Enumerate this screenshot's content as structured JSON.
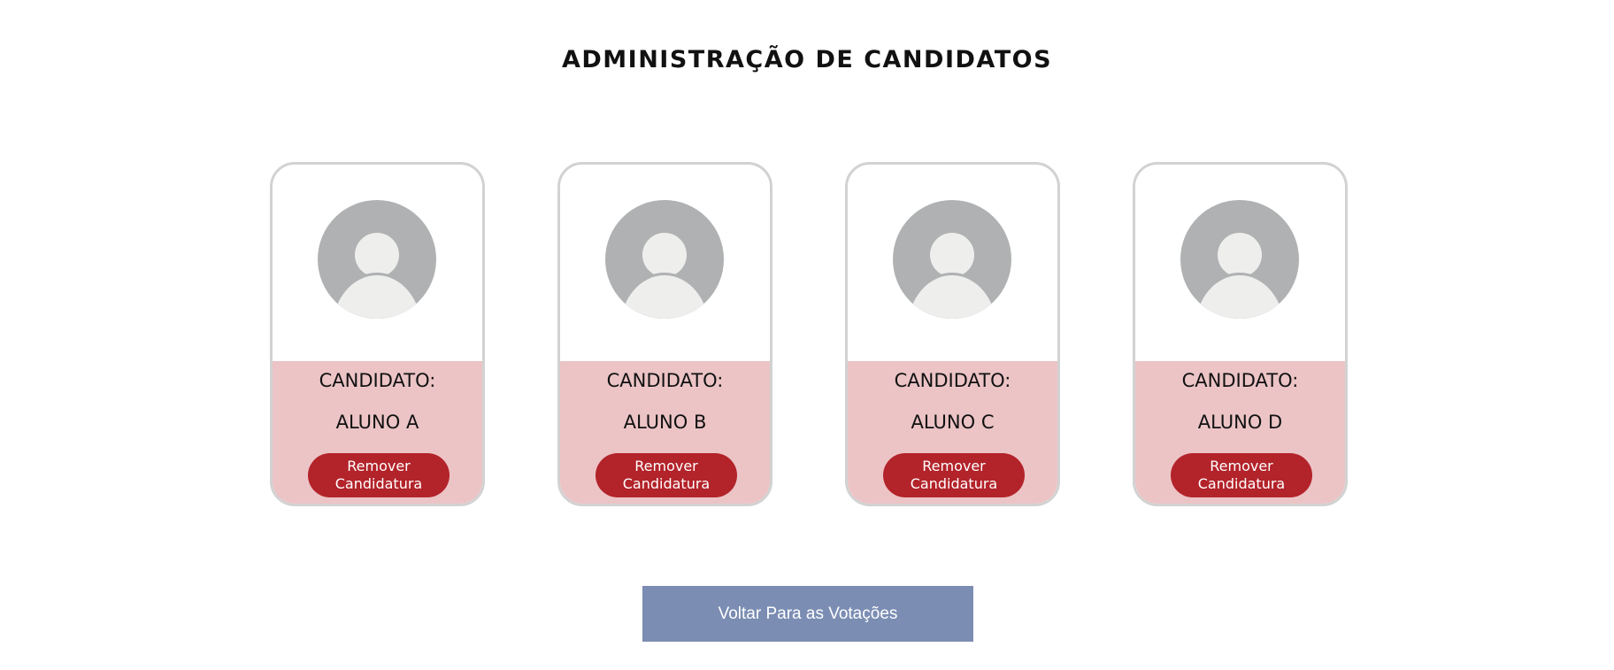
{
  "page": {
    "title": "ADMINISTRAÇÃO DE CANDIDATOS"
  },
  "candidates": [
    {
      "label": "CANDIDATO:",
      "name": "ALUNO A",
      "remove_line1": "Remover",
      "remove_line2": "Candidatura"
    },
    {
      "label": "CANDIDATO:",
      "name": "ALUNO B",
      "remove_line1": "Remover",
      "remove_line2": "Candidatura"
    },
    {
      "label": "CANDIDATO:",
      "name": "ALUNO C",
      "remove_line1": "Remover",
      "remove_line2": "Candidatura"
    },
    {
      "label": "CANDIDATO:",
      "name": "ALUNO D",
      "remove_line1": "Remover",
      "remove_line2": "Candidatura"
    }
  ],
  "footer": {
    "back_label": "Voltar Para as Votações"
  },
  "colors": {
    "card_bottom": "#ecc4c6",
    "remove_button": "#b3232a",
    "back_button": "#7b8db3",
    "avatar_bg": "#afb1b2",
    "avatar_fg": "#eeeeed"
  },
  "icons": {
    "avatar": "user-avatar-icon"
  }
}
